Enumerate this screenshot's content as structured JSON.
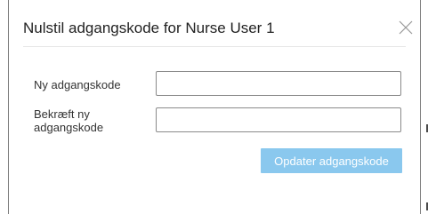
{
  "dialog": {
    "title": "Nulstil adgangskode for Nurse User 1",
    "close_icon": "close-icon"
  },
  "form": {
    "new_password_label": "Ny adgangskode",
    "new_password_value": "",
    "confirm_password_label": "Bekræft ny adgangskode",
    "confirm_password_value": "",
    "submit_label": "Opdater adgangskode"
  },
  "colors": {
    "button_bg": "#8ac8ee",
    "button_text": "#ffffff",
    "border": "#8a8a8a"
  }
}
